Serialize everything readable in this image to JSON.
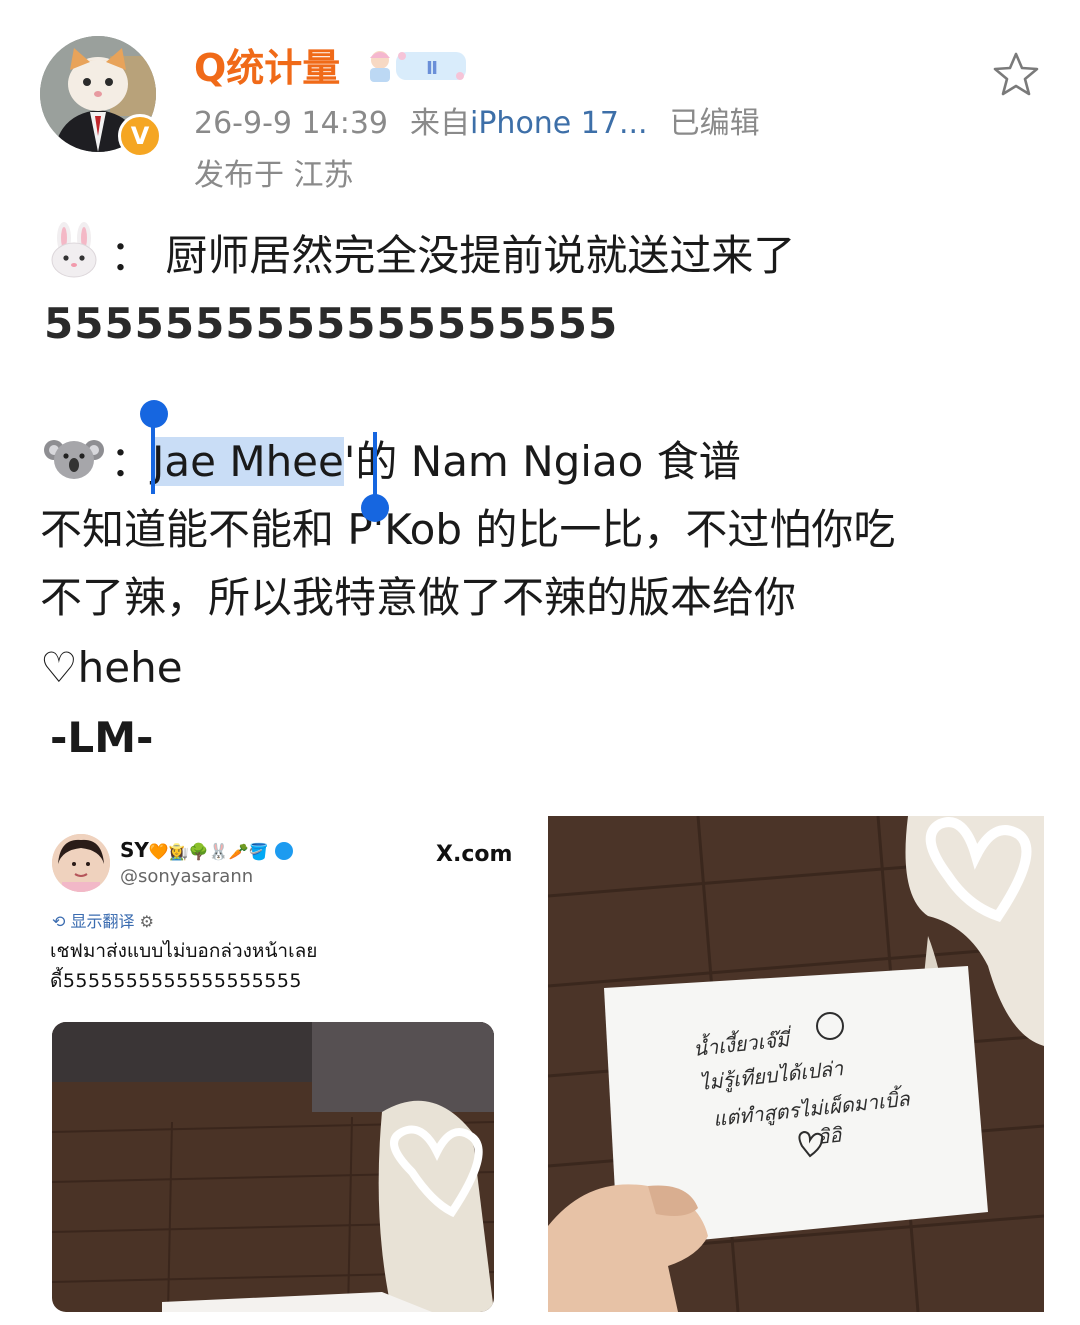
{
  "header": {
    "username": "Q统计量",
    "timestamp": "26-9-9 14:39",
    "source_prefix": "来自",
    "device": "iPhone 17...",
    "edited": "已编辑",
    "location": "发布于 江苏",
    "verified_badge": "V",
    "member_badge_text": "Ⅱ",
    "icons": [
      "avatar-cat",
      "verified-badge",
      "member-badge",
      "star-icon"
    ]
  },
  "post": {
    "line1_text": "：  厨师居然完全没提前说就送过来了",
    "line2_text": "5555555555555555555",
    "line3_selected": "Jae Mhee",
    "line3_rest": "'的 Nam Ngiao 食谱",
    "line4_text": "不知道能不能和 P'Kob 的比一比，不过怕你吃",
    "line5_text": "不了辣，所以我特意做了不辣的版本给你",
    "line6_text": "♡hehe",
    "line7_text": "-LM-",
    "icons": [
      "rabbit-emoji",
      "koala-emoji"
    ],
    "selection_color": "#c9ddf6",
    "handle_color": "#1666e0"
  },
  "tweet": {
    "name": "SY",
    "name_emojis": "🧡👩‍🌾🌳🐰🥕🪣",
    "handle": "@sonyasarann",
    "source": "X.com",
    "translate_label": "显示翻译",
    "text_line1": "เชฟมาส่งแบบไม่บอกล่วงหน้าเลย",
    "text_line2": "ดี้5555555555555555555"
  },
  "note": {
    "lines": [
      "น้ำเงี้ยวเจ๊มี่",
      "ไม่รู้เทียบได้เปล่า",
      "แต่ทำสูตรไม่เผ็ดมาเบิ้ล",
      "อิอิ"
    ]
  },
  "colors": {
    "username": "#f06a18",
    "meta": "#8a8a8a",
    "device": "#3d6fa8",
    "text": "#1a1a1a"
  }
}
